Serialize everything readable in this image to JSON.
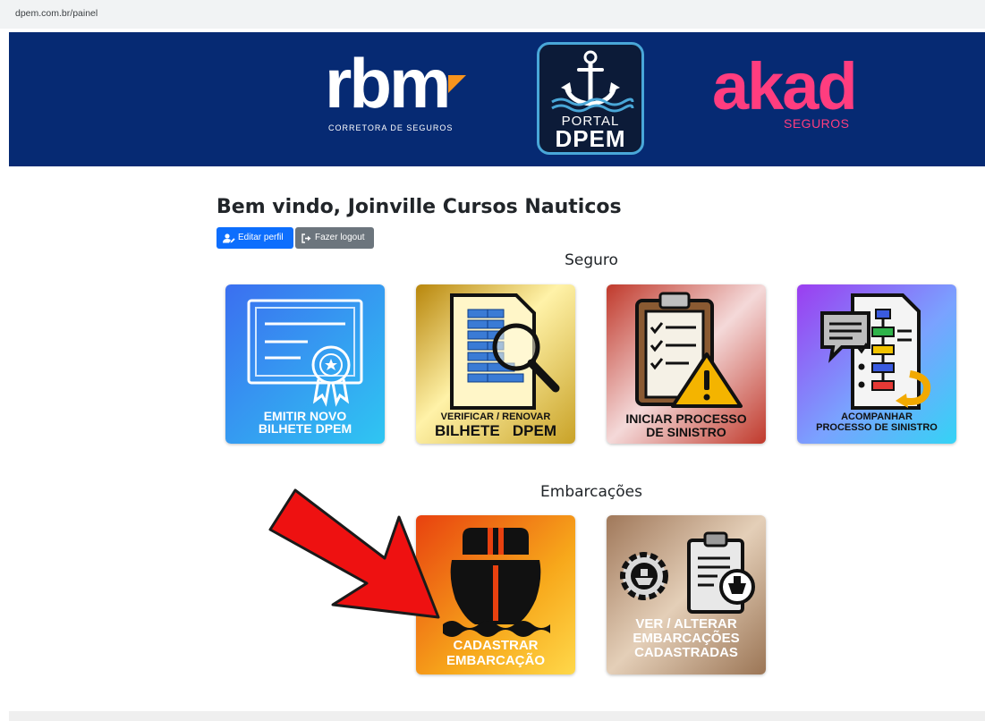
{
  "browser": {
    "url": "dpem.com.br/painel"
  },
  "header": {
    "left_logo": {
      "word": "rbm",
      "subtitle": "CORRETORA DE SEGUROS"
    },
    "center_logo": {
      "line1": "PORTAL",
      "line2": "DPEM"
    },
    "right_logo": {
      "word": "akad",
      "subtitle": "SEGUROS"
    }
  },
  "welcome": {
    "title": "Bem vindo, Joinville Cursos Nauticos"
  },
  "actions": {
    "edit_profile": "Editar perfil",
    "logout": "Fazer logout"
  },
  "sections": {
    "seguro": {
      "title": "Seguro",
      "tiles": [
        {
          "line1": "EMITIR NOVO",
          "line2": "BILHETE DPEM"
        },
        {
          "line1": "VERIFICAR / RENOVAR",
          "line2": "BILHETE   DPEM"
        },
        {
          "line1": "INICIAR PROCESSO",
          "line2": "DE SINISTRO"
        },
        {
          "line1": "ACOMPANHAR",
          "line2": "PROCESSO DE SINISTRO"
        }
      ]
    },
    "embarcacoes": {
      "title": "Embarcações",
      "tiles": [
        {
          "line1": "CADASTRAR",
          "line2": "EMBARCAÇÃO"
        },
        {
          "line1": "VER / ALTERAR",
          "line2": "EMBARCAÇÕES",
          "line3": "CADASTRADAS"
        }
      ]
    }
  },
  "colors": {
    "banner": "#062a73",
    "primary_button": "#0d6efd",
    "secondary_button": "#6c757d",
    "akad_pink": "#ff3d7f",
    "rbm_orange": "#f7941d",
    "arrow_red": "#ee1111"
  }
}
